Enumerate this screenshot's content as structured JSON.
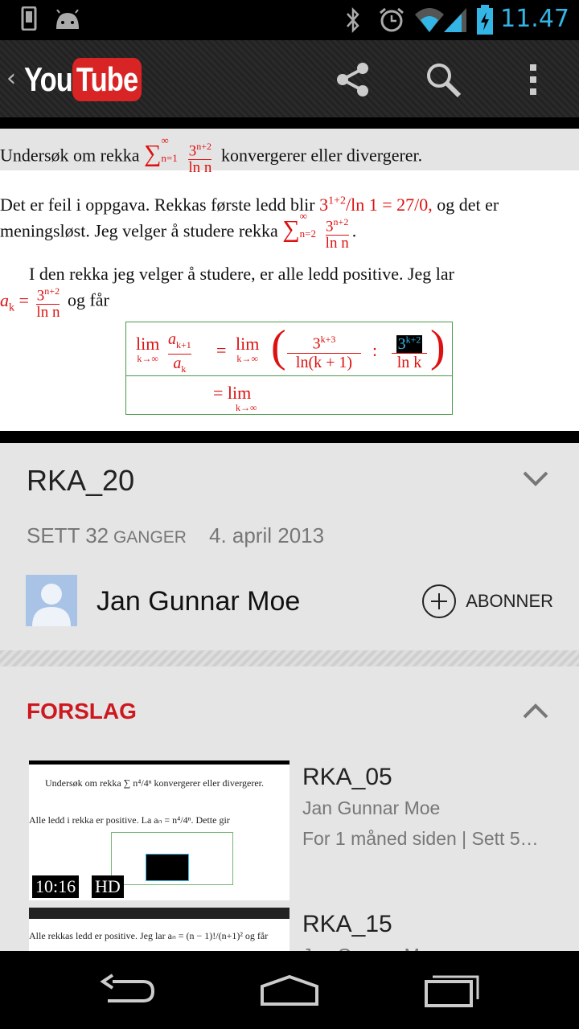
{
  "status_bar": {
    "time": "11.47",
    "accent_color": "#33b5e5",
    "icons": [
      "phone-icon",
      "android-icon",
      "bluetooth-icon",
      "alarm-icon",
      "wifi-icon",
      "signal-icon",
      "battery-charging-icon"
    ]
  },
  "action_bar": {
    "logo_you": "You",
    "logo_tube": "Tube",
    "brand_color": "#d82424",
    "actions": [
      "share-icon",
      "search-icon",
      "overflow-menu-icon"
    ]
  },
  "video_frame": {
    "task_prefix": "Undersøk om rekka ",
    "task_suffix": " konvergerer eller divergerer.",
    "line1_a": "Det er feil i oppgava. Rekkas første ledd blir ",
    "line1_math": "3",
    "line1_sup": "1+2",
    "line1_b": "/ln 1  =  27/0,",
    "line1_c": " og det er",
    "line2_a": "meningsløst. Jeg velger å studere rekka ",
    "line3": "I den rekka jeg velger å studere, er alle ledd positive. Jeg lar",
    "line4_var": "a",
    "line4_sub": "k",
    "line4_eq": " = ",
    "line4_b": " og får",
    "sum_sym": "∑",
    "sum_top": "∞",
    "sum_bot_n1": "n=1",
    "sum_bot_n2": "n=2",
    "frac_num": "3",
    "frac_num_sup": "n+2",
    "frac_den": "ln n",
    "lim": "lim",
    "lim_sub": "k→∞",
    "ratio_num": "a",
    "ratio_num_sub": "k+1",
    "ratio_den": "a",
    "ratio_den_sub": "k",
    "eq": "=",
    "f1_num": "3",
    "f1_sup": "k+3",
    "f1_den": "ln(k + 1)",
    "colon": ":",
    "f2_num": "3",
    "f2_sup": "k+2",
    "f2_den": "ln k",
    "row2": "= lim"
  },
  "video_info": {
    "title": "RKA_20",
    "views_label": "SETT 32",
    "views_unit": " GANGER",
    "date": "4. april 2013",
    "channel": "Jan Gunnar Moe",
    "subscribe": "ABONNER"
  },
  "suggestions": {
    "heading": "FORSLAG",
    "heading_color": "#cc181e",
    "items": [
      {
        "title": "RKA_05",
        "channel": "Jan Gunnar Moe",
        "meta": "For 1 måned siden | Sett 5…",
        "duration": "10:16",
        "badge": "HD",
        "thumb_line1": "Undersøk om rekka ∑ n⁴/4ⁿ konvergerer eller divergerer.",
        "thumb_line2": "Alle ledd i rekka er positive. La aₙ = n⁴/4ⁿ. Dette gir"
      },
      {
        "title": "RKA_15",
        "channel": "Jan Gunnar Moe",
        "thumb_line1": "Alle rekkas ledd er positive. Jeg lar aₙ = (n − 1)!/(n+1)² og får"
      }
    ]
  },
  "nav_bar": [
    "back-icon",
    "home-icon",
    "recent-apps-icon"
  ]
}
